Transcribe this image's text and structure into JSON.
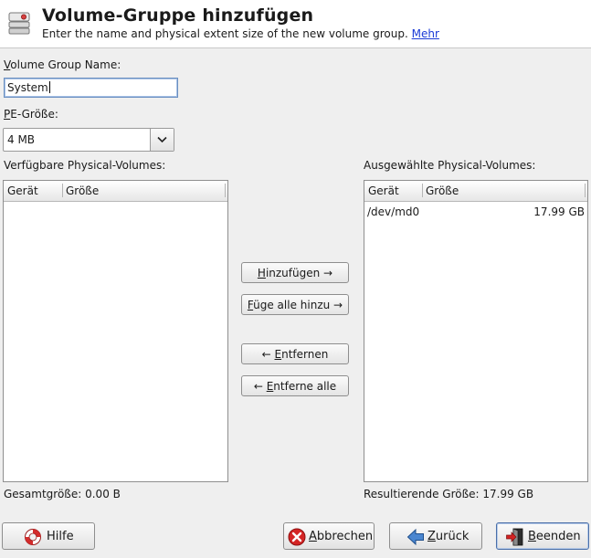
{
  "header": {
    "title": "Volume-Gruppe hinzufügen",
    "subtitle": "Enter the name and physical extent size of the new volume group.",
    "more_link": "Mehr",
    "icon": "disk-group-icon"
  },
  "form": {
    "name_label_first": "V",
    "name_label_rest": "olume Group Name:",
    "name_value": "System",
    "pe_label_first": "P",
    "pe_label_rest": "E-Größe:",
    "pe_value": "4 MB"
  },
  "available": {
    "title": "Verfügbare Physical-Volumes:",
    "columns": [
      "Gerät",
      "Größe"
    ],
    "rows": [],
    "total_label": "Gesamtgröße: 0.00 B"
  },
  "selected": {
    "title": "Ausgewählte Physical-Volumes:",
    "columns": [
      "Gerät",
      "Größe"
    ],
    "rows": [
      {
        "device": "/dev/md0",
        "size": "17.99 GB"
      }
    ],
    "total_label": "Resultierende Größe: 17.99 GB"
  },
  "transfer_buttons": {
    "add_first": "H",
    "add_rest": "inzufügen →",
    "add_all_first": "F",
    "add_all_rest": "üge alle hinzu →",
    "remove_pre": "← ",
    "remove_first": "E",
    "remove_rest": "ntfernen",
    "remove_all_pre": "← ",
    "remove_all_first": "E",
    "remove_all_rest": "ntferne alle"
  },
  "footer": {
    "help_first": "",
    "help_u": "",
    "help_label": "Hilfe",
    "cancel_first": "A",
    "cancel_rest": "bbrechen",
    "back_first": "Z",
    "back_rest": "urück",
    "finish_first": "B",
    "finish_rest": "eenden"
  }
}
